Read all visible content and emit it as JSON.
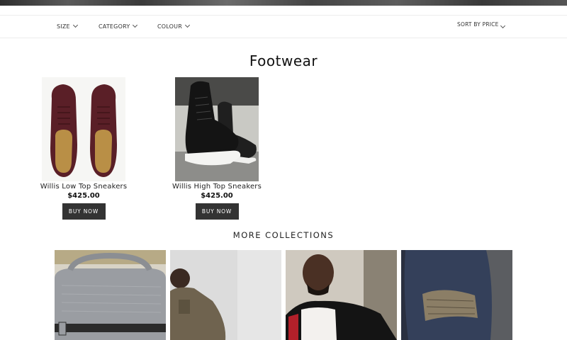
{
  "filters": {
    "size_label": "SIZE",
    "category_label": "CATEGORY",
    "colour_label": "COLOUR",
    "sort_label": "SORT BY PRICE"
  },
  "page_title": "Footwear",
  "products": [
    {
      "name": "Willis Low Top Sneakers",
      "price": "$425.00",
      "button": "BUY NOW"
    },
    {
      "name": "Willis High Top Sneakers",
      "price": "$425.00",
      "button": "BUY NOW"
    }
  ],
  "more_collections": {
    "title": "MORE COLLECTIONS"
  }
}
